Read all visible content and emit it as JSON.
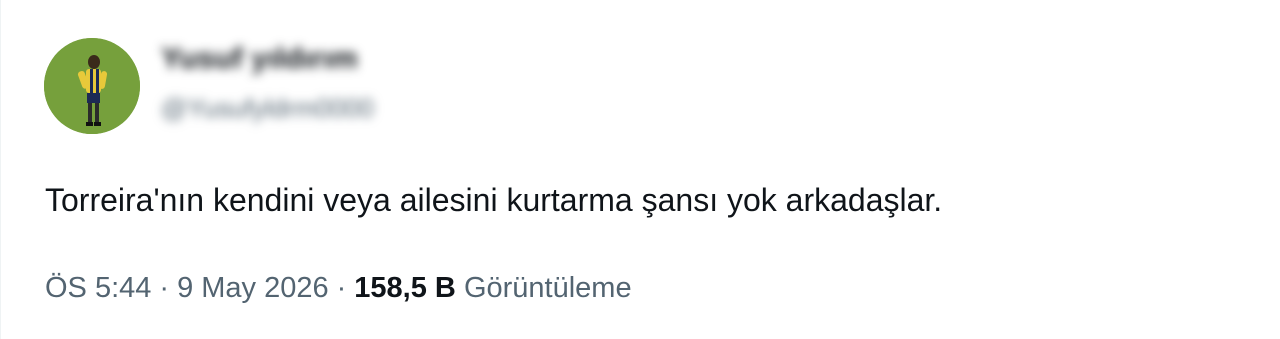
{
  "author": {
    "display_name": "Yusuf yıldırım",
    "handle": "@Yusufyldrm0000"
  },
  "tweet": {
    "text": "Torreira'nın kendini veya ailesini kurtarma şansı yok arkadaşlar."
  },
  "meta": {
    "time": "ÖS 5:44",
    "separator": "·",
    "date": "9 May 2026",
    "views_count": "158,5 B",
    "views_label": "Görüntüleme"
  },
  "colors": {
    "avatar_bg": "#76a03c",
    "text_primary": "#0f1419",
    "text_secondary": "#536471"
  },
  "icons": {
    "avatar": "person-photo-avatar"
  }
}
